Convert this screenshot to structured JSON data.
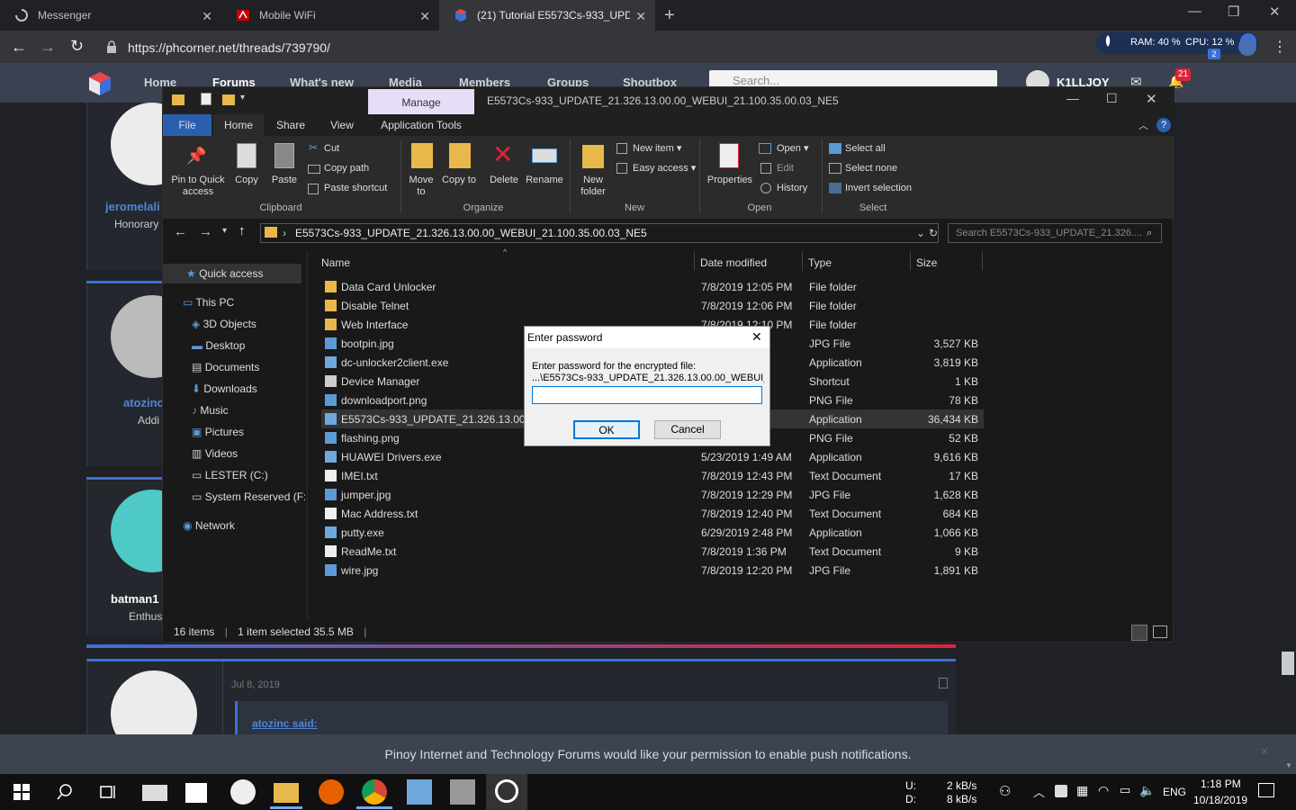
{
  "browser": {
    "tabs": [
      {
        "title": "Messenger"
      },
      {
        "title": "Mobile WiFi"
      },
      {
        "title": "(21) Tutorial E5573Cs-933_UPDA"
      }
    ],
    "url": "https://phcorner.net/threads/739790/",
    "ext_stats": {
      "ram": "RAM: 40 %",
      "cpu": "CPU: 12 %",
      "badge": "2"
    }
  },
  "site": {
    "nav": [
      "Home",
      "Forums",
      "What's new",
      "Media",
      "Members",
      "Groups",
      "Shoutbox"
    ],
    "search_placeholder": "Search...",
    "username": "K1LLJOY",
    "alert_count": "21",
    "posts": [
      {
        "user": "jeromelali",
        "title": "Honorary"
      },
      {
        "user": "atozinc",
        "title": "Addi"
      },
      {
        "user": "batman1",
        "title": "Enthus"
      }
    ],
    "post_date": "Jul 8, 2019",
    "quote": "atozinc said:",
    "notice": "Pinoy Internet and Technology Forums would like your permission to enable push notifications."
  },
  "explorer": {
    "manage": "Manage",
    "title": "E5573Cs-933_UPDATE_21.326.13.00.00_WEBUI_21.100.35.00.03_NE5",
    "tabs": [
      "File",
      "Home",
      "Share",
      "View",
      "Application Tools"
    ],
    "ribbon": {
      "pin": "Pin to Quick access",
      "copy": "Copy",
      "paste": "Paste",
      "cut": "Cut",
      "copy_path": "Copy path",
      "paste_shortcut": "Paste shortcut",
      "move_to": "Move to",
      "copy_to": "Copy to",
      "delete": "Delete",
      "rename": "Rename",
      "new_folder": "New folder",
      "new_item": "New item",
      "easy_access": "Easy access",
      "properties": "Properties",
      "open": "Open",
      "edit": "Edit",
      "history": "History",
      "select_all": "Select all",
      "select_none": "Select none",
      "invert_selection": "Invert selection",
      "groups": [
        "Clipboard",
        "Organize",
        "New",
        "Open",
        "Select"
      ]
    },
    "address": "E5573Cs-933_UPDATE_21.326.13.00.00_WEBUI_21.100.35.00.03_NE5",
    "search_placeholder": "Search E5573Cs-933_UPDATE_21.326....",
    "nav_items": [
      "Quick access",
      "This PC",
      "3D Objects",
      "Desktop",
      "Documents",
      "Downloads",
      "Music",
      "Pictures",
      "Videos",
      "LESTER (C:)",
      "System Reserved (F:",
      "Network"
    ],
    "columns": [
      "Name",
      "Date modified",
      "Type",
      "Size"
    ],
    "files": [
      {
        "name": "Data Card Unlocker",
        "date": "7/8/2019 12:05 PM",
        "type": "File folder",
        "size": ""
      },
      {
        "name": "Disable Telnet",
        "date": "7/8/2019 12:06 PM",
        "type": "File folder",
        "size": ""
      },
      {
        "name": "Web Interface",
        "date": "7/8/2019 12:10 PM",
        "type": "File folder",
        "size": ""
      },
      {
        "name": "bootpin.jpg",
        "date": "PM",
        "type": "JPG File",
        "size": "3,527 KB"
      },
      {
        "name": "dc-unlocker2client.exe",
        "date": "PM",
        "type": "Application",
        "size": "3,819 KB"
      },
      {
        "name": "Device Manager",
        "date": "PM",
        "type": "Shortcut",
        "size": "1 KB"
      },
      {
        "name": "downloadport.png",
        "date": "PM",
        "type": "PNG File",
        "size": "78 KB"
      },
      {
        "name": "E5573Cs-933_UPDATE_21.326.13.00.00_",
        "date": "AM",
        "type": "Application",
        "size": "36,434 KB"
      },
      {
        "name": "flashing.png",
        "date": "M",
        "type": "PNG File",
        "size": "52 KB"
      },
      {
        "name": "HUAWEI Drivers.exe",
        "date": "5/23/2019 1:49 AM",
        "type": "Application",
        "size": "9,616 KB"
      },
      {
        "name": "IMEI.txt",
        "date": "7/8/2019 12:43 PM",
        "type": "Text Document",
        "size": "17 KB"
      },
      {
        "name": "jumper.jpg",
        "date": "7/8/2019 12:29 PM",
        "type": "JPG File",
        "size": "1,628 KB"
      },
      {
        "name": "Mac Address.txt",
        "date": "7/8/2019 12:40 PM",
        "type": "Text Document",
        "size": "684 KB"
      },
      {
        "name": "putty.exe",
        "date": "6/29/2019 2:48 PM",
        "type": "Application",
        "size": "1,066 KB"
      },
      {
        "name": "ReadMe.txt",
        "date": "7/8/2019 1:36 PM",
        "type": "Text Document",
        "size": "9 KB"
      },
      {
        "name": "wire.jpg",
        "date": "7/8/2019 12:20 PM",
        "type": "JPG File",
        "size": "1,891 KB"
      }
    ],
    "status_items": "16 items",
    "status_selected": "1 item selected  35.5 MB"
  },
  "dialog": {
    "title": "Enter password",
    "prompt": "Enter password for the encrypted file:",
    "file": "...\\E5573Cs-933_UPDATE_21.326.13.00.00_WEBUI_",
    "ok": "OK",
    "cancel": "Cancel"
  },
  "taskbar": {
    "net_up_label": "U:",
    "net_down_label": "D:",
    "net_up": "2 kB/s",
    "net_down": "8 kB/s",
    "lang": "ENG",
    "time": "1:18 PM",
    "date": "10/18/2019"
  }
}
